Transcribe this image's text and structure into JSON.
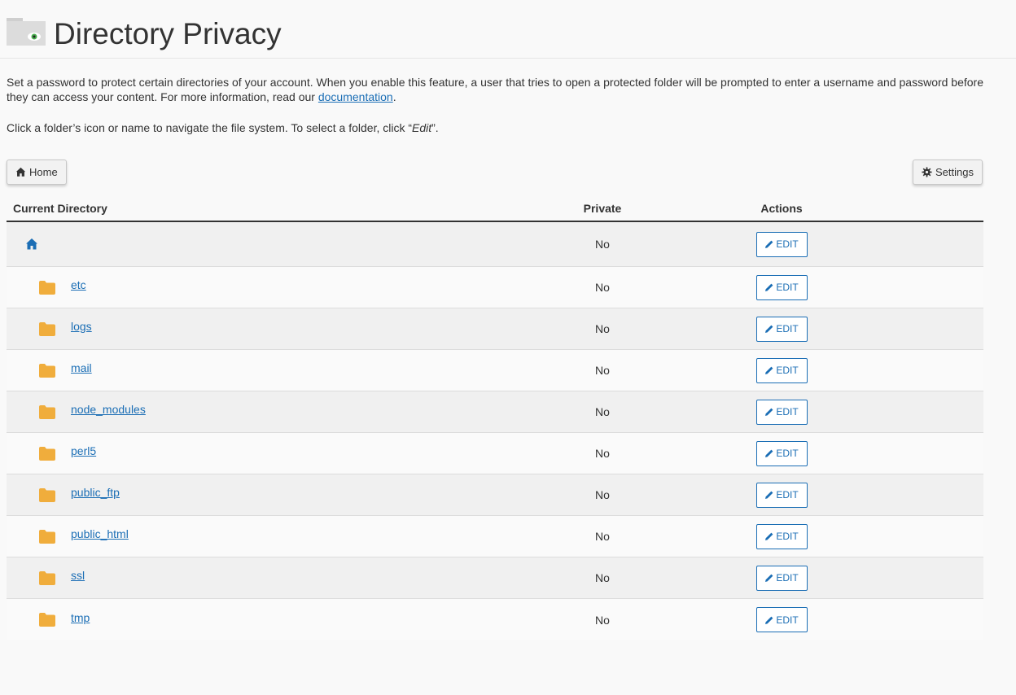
{
  "header": {
    "title": "Directory Privacy",
    "icon": "folder-eye-icon"
  },
  "description": {
    "text_before_link": "Set a password to protect certain directories of your account. When you enable this feature, a user that tries to open a protected folder will be prompted to enter a username and password before they can access your content. For more information, read our ",
    "link_text": "documentation",
    "text_after_link": "."
  },
  "hint": {
    "before": "Click a folder’s icon or name to navigate the file system. To select a folder, click “",
    "edit_word": "Edit",
    "after": "”."
  },
  "toolbar": {
    "home_label": "Home",
    "settings_label": "Settings"
  },
  "table": {
    "headers": {
      "directory": "Current Directory",
      "private": "Private",
      "actions": "Actions"
    },
    "root": {
      "private": "No",
      "action": "EDIT"
    },
    "rows": [
      {
        "name": "etc",
        "private": "No",
        "action": "EDIT"
      },
      {
        "name": "logs",
        "private": "No",
        "action": "EDIT"
      },
      {
        "name": "mail",
        "private": "No",
        "action": "EDIT"
      },
      {
        "name": "node_modules",
        "private": "No",
        "action": "EDIT"
      },
      {
        "name": "perl5",
        "private": "No",
        "action": "EDIT"
      },
      {
        "name": "public_ftp",
        "private": "No",
        "action": "EDIT"
      },
      {
        "name": "public_html",
        "private": "No",
        "action": "EDIT"
      },
      {
        "name": "ssl",
        "private": "No",
        "action": "EDIT"
      },
      {
        "name": "tmp",
        "private": "No",
        "action": "EDIT"
      }
    ]
  },
  "colors": {
    "link": "#1b6eb5",
    "folder": "#f0ad3c"
  }
}
